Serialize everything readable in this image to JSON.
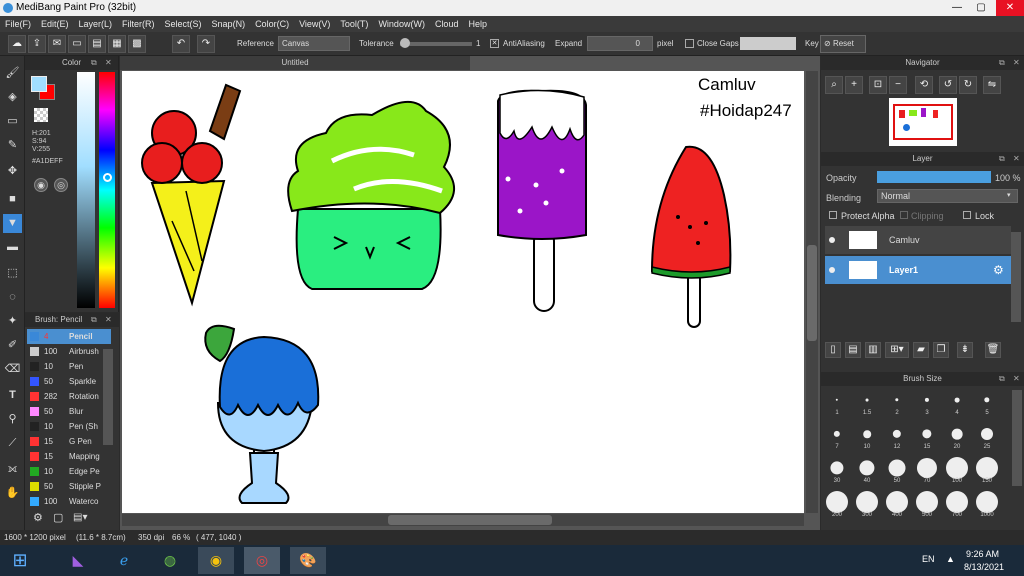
{
  "window": {
    "title": "MediBang Paint Pro (32bit)",
    "min": "—",
    "max": "▢",
    "close": "✕"
  },
  "menu": [
    "File(F)",
    "Edit(E)",
    "Layer(L)",
    "Filter(R)",
    "Select(S)",
    "Snap(N)",
    "Color(C)",
    "View(V)",
    "Tool(T)",
    "Window(W)",
    "Cloud",
    "Help"
  ],
  "toolbar": {
    "reference_label": "Reference",
    "reference_value": "Canvas",
    "tolerance_label": "Tolerance",
    "tolerance_value": "1",
    "tolerance_level": 0.0,
    "antialiasing_label": "AntiAliasing",
    "antialiasing_checked": true,
    "expand_label": "Expand",
    "expand_value": "0",
    "expand_unit": "pixel",
    "close_gaps_label": "Close Gaps",
    "close_gaps_checked": false,
    "key_label": "Key",
    "reset_label": "Reset"
  },
  "color_panel": {
    "title": "Color",
    "h": "H:201",
    "s": "S:94",
    "v": "V:255",
    "hex": "#A1DEFF",
    "primary": "#a1deff",
    "secondary": "#ff0000"
  },
  "brush_panel": {
    "title": "Brush: Pencil",
    "items": [
      {
        "size": "4",
        "name": "Pencil",
        "color": "#3a88d8",
        "selected": true
      },
      {
        "size": "100",
        "name": "Airbrush",
        "color": "#cccccc"
      },
      {
        "size": "10",
        "name": "Pen",
        "color": "#222222"
      },
      {
        "size": "50",
        "name": "Sparkle",
        "color": "#3355ff"
      },
      {
        "size": "282",
        "name": "Rotation",
        "color": "#ff3333"
      },
      {
        "size": "50",
        "name": "Blur",
        "color": "#ff88ff"
      },
      {
        "size": "10",
        "name": "Pen (Sh",
        "color": "#222222"
      },
      {
        "size": "15",
        "name": "G Pen",
        "color": "#ff3333"
      },
      {
        "size": "15",
        "name": "Mapping",
        "color": "#ff3333"
      },
      {
        "size": "10",
        "name": "Edge Pe",
        "color": "#22aa22"
      },
      {
        "size": "50",
        "name": "Stipple P",
        "color": "#dddd00"
      },
      {
        "size": "100",
        "name": "Waterco",
        "color": "#33aaff"
      }
    ]
  },
  "canvas": {
    "tab": "Untitled",
    "text1": "Camluv",
    "text2": "#Hoidap247"
  },
  "navigator": {
    "title": "Navigator"
  },
  "layer_panel": {
    "title": "Layer",
    "opacity_label": "Opacity",
    "opacity_value": "100 %",
    "opacity_level": 1.0,
    "blending_label": "Blending",
    "blending_value": "Normal",
    "protect_alpha": "Protect Alpha",
    "clipping": "Clipping",
    "lock": "Lock",
    "layers": [
      {
        "name": "Camluv",
        "selected": false
      },
      {
        "name": "Layer1",
        "selected": true
      }
    ]
  },
  "brush_size": {
    "title": "Brush Size",
    "sizes": [
      "1",
      "1.5",
      "2",
      "3",
      "4",
      "5",
      "7",
      "10",
      "12",
      "15",
      "20",
      "25",
      "30",
      "40",
      "50",
      "70",
      "100",
      "150",
      "200",
      "300",
      "400",
      "500",
      "700",
      "1000"
    ]
  },
  "status": {
    "dimensions": "1600 * 1200 pixel",
    "physical": "(11.6 * 8.7cm)",
    "dpi": "350 dpi",
    "zoom": "66 %",
    "coords": "( 477, 1040 )"
  },
  "taskbar": {
    "lang": "EN",
    "time": "9:26 AM",
    "date": "8/13/2021"
  }
}
